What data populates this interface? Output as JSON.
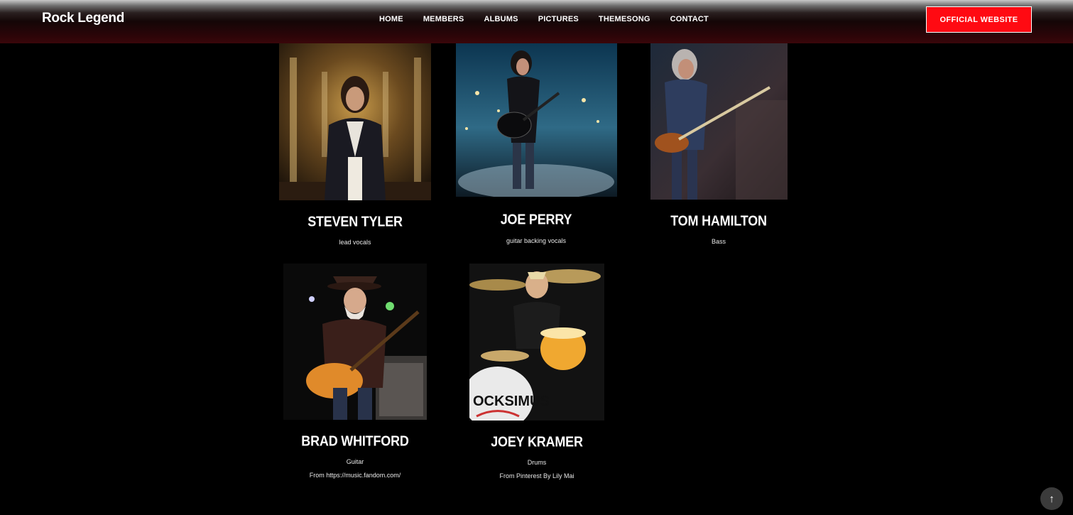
{
  "header": {
    "brand": "Rock Legend",
    "nav": [
      "HOME",
      "MEMBERS",
      "ALBUMS",
      "PICTURES",
      "THEMESONG",
      "CONTACT"
    ],
    "cta_label": "OFFICIAL WEBSITE",
    "cta_color": "#ff0a12"
  },
  "members": [
    {
      "name": "STEVEN TYLER",
      "role": "lead vocals",
      "credit": ""
    },
    {
      "name": "JOE PERRY",
      "role": "guitar backing vocals",
      "credit": ""
    },
    {
      "name": "TOM HAMILTON",
      "role": "Bass",
      "credit": ""
    },
    {
      "name": "BRAD WHITFORD",
      "role": "Guitar",
      "credit": "From https://music.fandom.com/"
    },
    {
      "name": "JOEY KRAMER",
      "role": "Drums",
      "credit": "From Pinterest By Lily Mai"
    }
  ],
  "scroll_top_icon": "arrow-up-icon"
}
